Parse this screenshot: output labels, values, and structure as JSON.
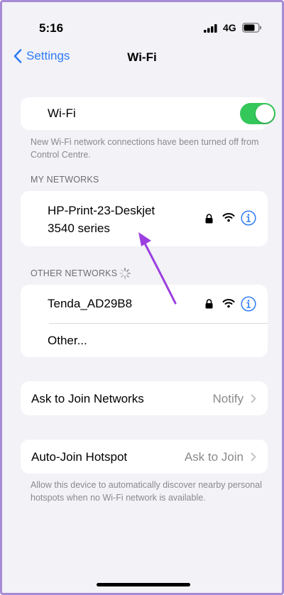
{
  "status_bar": {
    "time": "5:16",
    "network": "4G"
  },
  "nav": {
    "back_label": "Settings",
    "title": "Wi-Fi"
  },
  "wifi_toggle": {
    "label": "Wi-Fi",
    "on": true
  },
  "wifi_note": "New Wi-Fi network connections have been turned off from Control Centre.",
  "my_networks": {
    "header": "MY NETWORKS",
    "items": [
      {
        "name_line1": "HP-Print-23-Deskjet",
        "name_line2": "3540 series",
        "locked": true
      }
    ]
  },
  "other_networks": {
    "header": "OTHER NETWORKS",
    "items": [
      {
        "name": "Tenda_AD29B8",
        "locked": true
      }
    ],
    "other_label": "Other..."
  },
  "ask_to_join": {
    "label": "Ask to Join Networks",
    "value": "Notify"
  },
  "auto_join": {
    "label": "Auto-Join Hotspot",
    "value": "Ask to Join",
    "note": "Allow this device to automatically discover nearby personal hotspots when no Wi-Fi network is available."
  },
  "colors": {
    "accent": "#2f7bf6",
    "toggle_on": "#34c759",
    "annotation_arrow": "#9b3fe0",
    "frame": "#a78bd6"
  },
  "icons": [
    "chevron-left-icon",
    "lock-icon",
    "wifi-icon",
    "info-icon",
    "chevron-right-icon",
    "spinner-icon",
    "signal-icon",
    "battery-icon"
  ]
}
